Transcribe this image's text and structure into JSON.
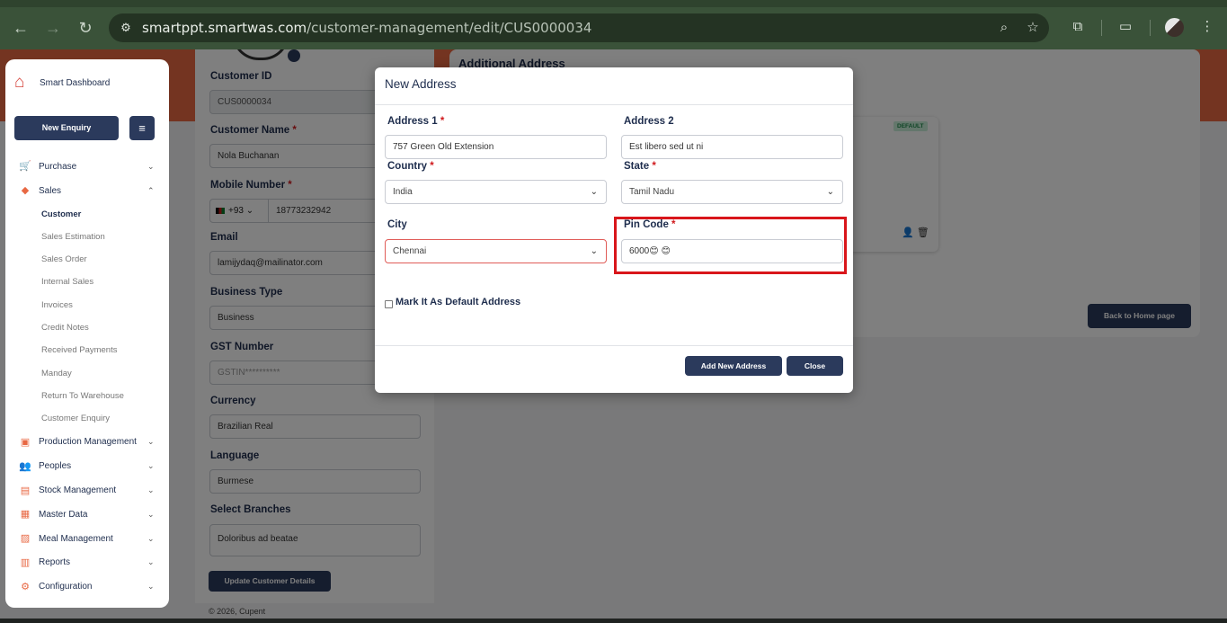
{
  "browser": {
    "url_host": "smartppt.smartwas.com",
    "url_path": "/customer-management/edit/CUS0000034"
  },
  "sidebar": {
    "brand": "Smart Dashboard",
    "new_enquiry": "New Enquiry",
    "items": [
      {
        "label": "Purchase",
        "icon": "cart-icon"
      },
      {
        "label": "Sales",
        "icon": "sales-icon"
      },
      {
        "label": "Production Management",
        "icon": "factory-icon"
      },
      {
        "label": "Peoples",
        "icon": "people-icon"
      },
      {
        "label": "Stock Management",
        "icon": "box-icon"
      },
      {
        "label": "Master Data",
        "icon": "database-icon"
      },
      {
        "label": "Meal Management",
        "icon": "meal-icon"
      },
      {
        "label": "Reports",
        "icon": "report-icon"
      },
      {
        "label": "Configuration",
        "icon": "settings-icon"
      }
    ],
    "sales_sub": [
      "Customer",
      "Sales Estimation",
      "Sales Order",
      "Internal Sales",
      "Invoices",
      "Credit Notes",
      "Received Payments",
      "Manday",
      "Return To Warehouse",
      "Customer Enquiry"
    ]
  },
  "customer_form": {
    "customer_id_label": "Customer ID",
    "customer_id": "CUS0000034",
    "customer_name_label": "Customer Name",
    "customer_name": "Nola Buchanan",
    "mobile_label": "Mobile Number",
    "mobile_code": "+93",
    "mobile": "18773232942",
    "email_label": "Email",
    "email": "lamijydaq@mailinator.com",
    "business_type_label": "Business Type",
    "business_type": "Business",
    "gst_label": "GST Number",
    "gst_placeholder": "GSTIN**********",
    "currency_label": "Currency",
    "currency": "Brazilian Real",
    "language_label": "Language",
    "language": "Burmese",
    "branches_label": "Select Branches",
    "branches": "Doloribus ad beatae",
    "update_button": "Update Customer Details",
    "footer": "© 2026, Cupent",
    "required_mark": "*"
  },
  "additional_address": {
    "title": "Additional Address",
    "default_badge": "DEFAULT",
    "back_button": "Back to Home page"
  },
  "modal": {
    "title": "New Address",
    "address1_label": "Address 1",
    "address1": "757 Green Old Extension",
    "address2_label": "Address 2",
    "address2": "Est libero sed ut ni",
    "country_label": "Country",
    "country": "India",
    "state_label": "State",
    "state": "Tamil Nadu",
    "city_label": "City",
    "city": "Chennai",
    "pincode_label": "Pin Code",
    "pincode": "6000😊 😊",
    "default_checkbox_label": "Mark It As Default Address",
    "add_button": "Add New Address",
    "close_button": "Close",
    "required_mark": "*"
  }
}
